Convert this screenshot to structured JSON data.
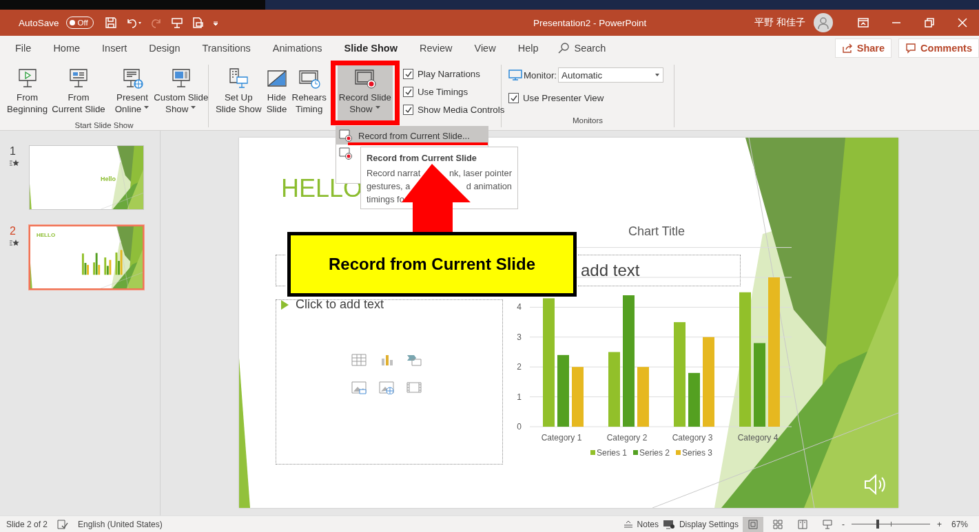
{
  "title_bar": {
    "autosave_label": "AutoSave",
    "autosave": {
      "on": false,
      "label": "Off"
    },
    "title": "Presentation2  -  PowerPoint",
    "user": "平野 和佳子"
  },
  "tabs": [
    {
      "label": "File",
      "selected": false
    },
    {
      "label": "Home",
      "selected": false
    },
    {
      "label": "Insert",
      "selected": false
    },
    {
      "label": "Design",
      "selected": false
    },
    {
      "label": "Transitions",
      "selected": false
    },
    {
      "label": "Animations",
      "selected": false
    },
    {
      "label": "Slide Show",
      "selected": true
    },
    {
      "label": "Review",
      "selected": false
    },
    {
      "label": "View",
      "selected": false
    },
    {
      "label": "Help",
      "selected": false
    }
  ],
  "search": {
    "placeholder": "Search"
  },
  "share_button": "Share",
  "comments_button": "Comments",
  "ribbon": {
    "groups": [
      {
        "label": "Start Slide Show",
        "buttons": [
          {
            "lines": [
              "From",
              "Beginning"
            ],
            "dropdown": false,
            "pressed": false
          },
          {
            "lines": [
              "From",
              "Current Slide"
            ],
            "dropdown": false,
            "pressed": false
          },
          {
            "lines": [
              "Present",
              "Online"
            ],
            "dropdown": true,
            "pressed": false
          },
          {
            "lines": [
              "Custom Slide",
              "Show"
            ],
            "dropdown": true,
            "pressed": false
          }
        ]
      },
      {
        "buttons": [
          {
            "lines": [
              "Set Up",
              "Slide Show"
            ],
            "dropdown": false,
            "pressed": false
          },
          {
            "lines": [
              "Hide",
              "Slide"
            ],
            "dropdown": false,
            "pressed": false
          },
          {
            "lines": [
              "Rehears",
              "Timing"
            ],
            "dropdown": false,
            "pressed": false
          },
          {
            "lines": [
              "Record Slide",
              "Show"
            ],
            "dropdown": true,
            "pressed": true
          }
        ],
        "checkboxes": [
          {
            "label": "Play Narrations",
            "checked": true
          },
          {
            "label": "Use Timings",
            "checked": true
          },
          {
            "label": "Show Media Controls",
            "checked": true
          }
        ]
      },
      {
        "label": "Monitors",
        "monitor": {
          "label": "Monitor:",
          "value": "Automatic"
        },
        "checkboxes": [
          {
            "label": "Use Presenter View",
            "checked": true
          }
        ]
      }
    ]
  },
  "thumbnails": [
    {
      "number": "1",
      "kind": "title",
      "title": "Hello",
      "selected": false
    },
    {
      "number": "2",
      "kind": "chart",
      "title": "HELLO",
      "selected": true
    }
  ],
  "slide": {
    "title": "HELLO",
    "title_placeholder": {
      "text": "add text"
    },
    "bullet": "Click to add text",
    "chart": {
      "chart_data": {
        "type": "bar",
        "title": "Chart Title",
        "categories": [
          "Category 1",
          "Category 2",
          "Category 3",
          "Category 4"
        ],
        "series": [
          {
            "name": "Series 1",
            "color": "#92c02a",
            "values": [
              4.3,
              2.5,
              3.5,
              4.5
            ]
          },
          {
            "name": "Series 2",
            "color": "#54a021",
            "values": [
              2.4,
              4.4,
              1.8,
              2.8
            ]
          },
          {
            "name": "Series 3",
            "color": "#e6b820",
            "values": [
              2,
              2,
              3,
              5
            ]
          }
        ],
        "ylim": [
          0,
          6
        ],
        "yticks": [
          0,
          1,
          2,
          3,
          4
        ],
        "grid": true,
        "legend": true
      }
    }
  },
  "record_menu": {
    "items": [
      {
        "label": "Record from Current Slide...",
        "selected": true
      },
      {
        "selected": false
      }
    ]
  },
  "tooltip": {
    "title": "Record from Current Slide",
    "lines": [
      [
        "Record narrat",
        "nk, laser pointer"
      ],
      [
        "gestures, a",
        "d animation"
      ],
      [
        "timings fo"
      ]
    ]
  },
  "callout": {
    "text": "Record from Current Slide"
  },
  "status_bar": {
    "slide": "Slide 2 of 2",
    "language": "English (United States)",
    "notes": "Notes",
    "display": "Display Settings",
    "views": [
      {
        "selected": true
      },
      {
        "selected": false
      },
      {
        "selected": false
      },
      {
        "selected": false
      }
    ],
    "zoom": {
      "minus": "-",
      "plus": "+",
      "level": 0.33,
      "value": "67%"
    }
  }
}
